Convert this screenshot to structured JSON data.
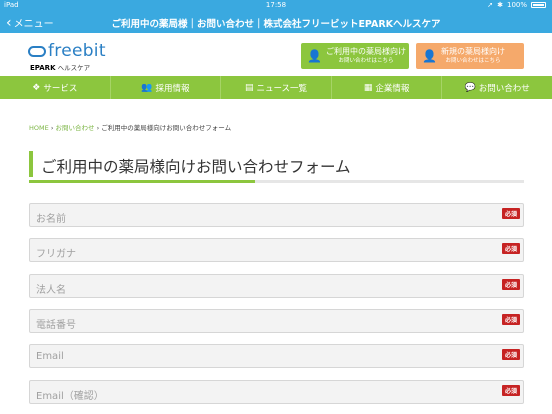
{
  "status_bar": {
    "device": "iPad",
    "time": "17:58",
    "battery": "100%"
  },
  "nav": {
    "back_label": "メニュー",
    "title": "ご利用中の薬局様｜お問い合わせ｜株式会社フリービットEPARKヘルスケア"
  },
  "logo": {
    "brand": "freebit",
    "sub_brand": "EPARK",
    "sub_text": "ヘルスケア"
  },
  "header_buttons": [
    {
      "title": "ご利用中の薬局様向け",
      "sub": "お問い合わせはこちら",
      "color": "#8cc63e",
      "icon": "user-icon"
    },
    {
      "title": "新規の薬局様向け",
      "sub": "お問い合わせはこちら",
      "color": "#f5a96b",
      "icon": "add-user-icon"
    }
  ],
  "menu": {
    "items": [
      {
        "label": "サービス",
        "icon": "services-icon"
      },
      {
        "label": "採用情報",
        "icon": "people-icon"
      },
      {
        "label": "ニュース一覧",
        "icon": "document-icon"
      },
      {
        "label": "企業情報",
        "icon": "building-icon"
      },
      {
        "label": "お問い合わせ",
        "icon": "chat-icon"
      }
    ]
  },
  "breadcrumb": {
    "home": "HOME",
    "sep": "›",
    "contact": "お問い合わせ",
    "current": "ご利用中の薬局様向けお問い合わせフォーム"
  },
  "page_title": "ご利用中の薬局様向けお問い合わせフォーム",
  "form": {
    "required_label": "必須",
    "fields": [
      {
        "placeholder": "お名前"
      },
      {
        "placeholder": "フリガナ"
      },
      {
        "placeholder": "法人名"
      },
      {
        "placeholder": "電話番号"
      },
      {
        "placeholder": "Email"
      },
      {
        "placeholder": "Email（確認）"
      }
    ]
  },
  "colors": {
    "nav_blue": "#3aa9e0",
    "accent_green": "#8cc63e",
    "accent_orange": "#f5a96b",
    "required_red": "#c62323"
  }
}
